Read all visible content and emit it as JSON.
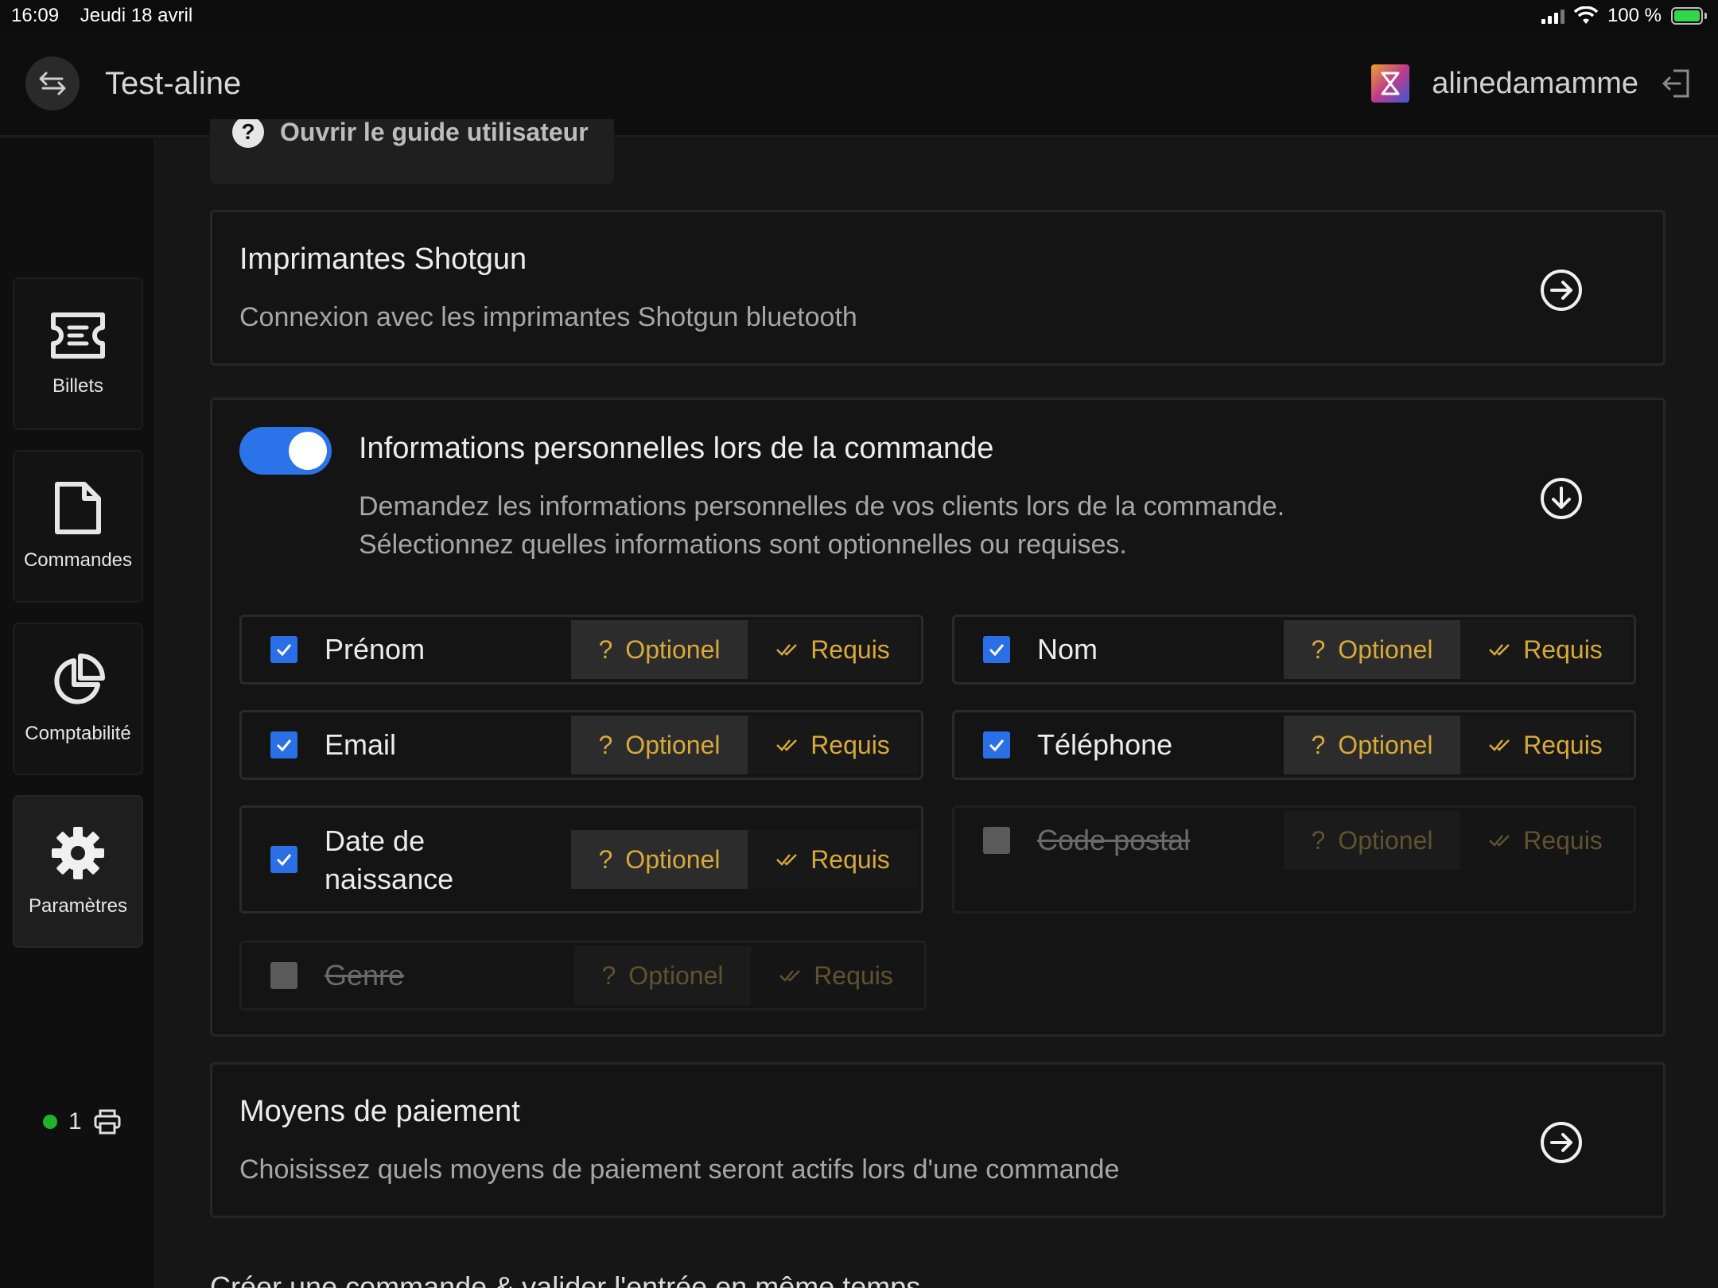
{
  "status_bar": {
    "time": "16:09",
    "date": "Jeudi 18 avril",
    "battery": "100 %"
  },
  "header": {
    "event_title": "Test-aline",
    "username": "alinedamamme"
  },
  "sidebar": {
    "items": [
      {
        "label": "Billets",
        "icon": "ticket-icon"
      },
      {
        "label": "Commandes",
        "icon": "document-icon"
      },
      {
        "label": "Comptabilité",
        "icon": "pie-chart-icon"
      },
      {
        "label": "Paramètres",
        "icon": "gear-icon"
      }
    ],
    "printer_count": "1"
  },
  "guide_button": {
    "label": "Ouvrir le guide utilisateur"
  },
  "printers_card": {
    "title": "Imprimantes Shotgun",
    "description": "Connexion avec les imprimantes Shotgun bluetooth"
  },
  "personal_info_card": {
    "title": "Informations personnelles lors de la commande",
    "description_line1": "Demandez les informations personnelles de vos clients lors de la commande.",
    "description_line2": "Sélectionnez quelles informations sont optionnelles ou requises.",
    "toggle_on": true,
    "optional_label": "Optionel",
    "required_label": "Requis",
    "fields": [
      {
        "label": "Prénom",
        "checked": true
      },
      {
        "label": "Nom",
        "checked": true
      },
      {
        "label": "Email",
        "checked": true
      },
      {
        "label": "Téléphone",
        "checked": true
      },
      {
        "label_line1": "Date de",
        "label_line2": "naissance",
        "checked": true
      },
      {
        "label": "Code postal",
        "checked": false
      },
      {
        "label": "Genre",
        "checked": false
      }
    ]
  },
  "payment_card": {
    "title": "Moyens de paiement",
    "description": "Choisissez quels moyens de paiement seront actifs lors d'une commande"
  },
  "bottom_text": "Créer une commande & valider l'entrée en même temps",
  "colors": {
    "accent_blue": "#2a73e8",
    "gold": "#d7a93a",
    "online_green": "#1fb32c"
  }
}
